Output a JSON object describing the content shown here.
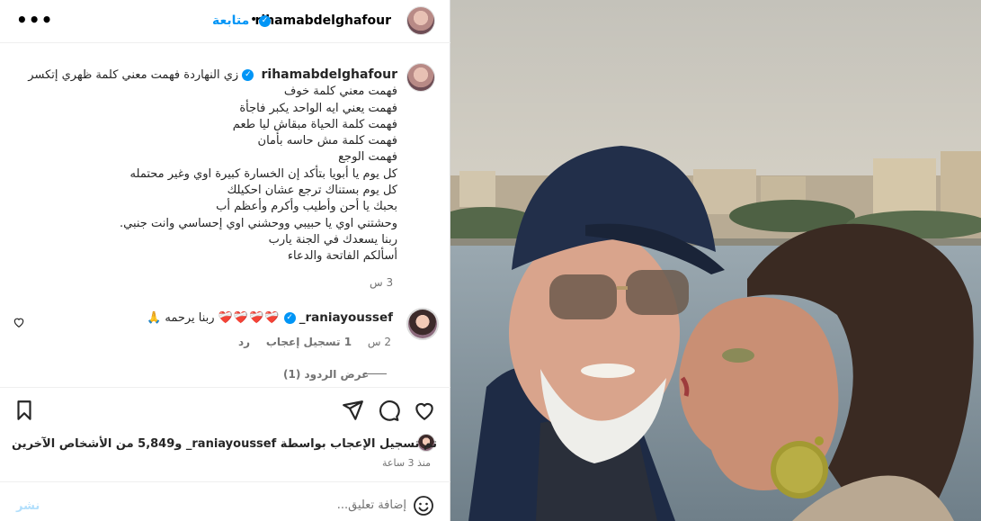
{
  "header": {
    "username": "rihamabdelghafour",
    "follow_label": "متابعة",
    "more_label": "•••"
  },
  "caption": {
    "username": "rihamabdelghafour",
    "lines": [
      "زي النهاردة فهمت معني كلمة ظهري إتكسر",
      "فهمت معني كلمة خوف",
      "فهمت يعني ايه الواحد يكبر فاجأة",
      "فهمت كلمة الحياة مبقاش ليا طعم",
      "فهمت كلمة مش حاسه بأمان",
      "فهمت الوجع",
      "كل يوم يا أبويا بتأكد إن الخسارة كبيرة اوي وغير محتمله",
      "كل يوم بستناك ترجع عشان احكيلك",
      "بحبك يا أحن وأطيب وأكرم وأعظم أب",
      "وحشتني اوي يا حبيبي ووحشني اوي إحساسي وانت جنبي.",
      "ربنا يسعدك في الجنة يارب",
      "أسألكم الفاتحة والدعاء"
    ],
    "time": "3 س"
  },
  "comment": {
    "username": "raniayoussef_",
    "hearts": "❤️‍🩹❤️‍🩹❤️‍🩹❤️‍🩹",
    "text": "ربنا يرحمه 🙏",
    "time": "2 س",
    "likes": "1 تسجيل إعجاب",
    "reply_label": "رد",
    "view_replies": "عرض الردود (1)"
  },
  "likes_summary": "تم تسجيل الإعجاب بواسطة raniayoussef_ و5,849 من الأشخاص الآخرين",
  "posted_ago": "منذ 3 ساعة",
  "comment_box": {
    "placeholder": "إضافة تعليق...",
    "post_label": "نشر"
  },
  "colors": {
    "accent": "#0095f6",
    "heart_red": "#c91c2c",
    "muted": "#737373"
  }
}
